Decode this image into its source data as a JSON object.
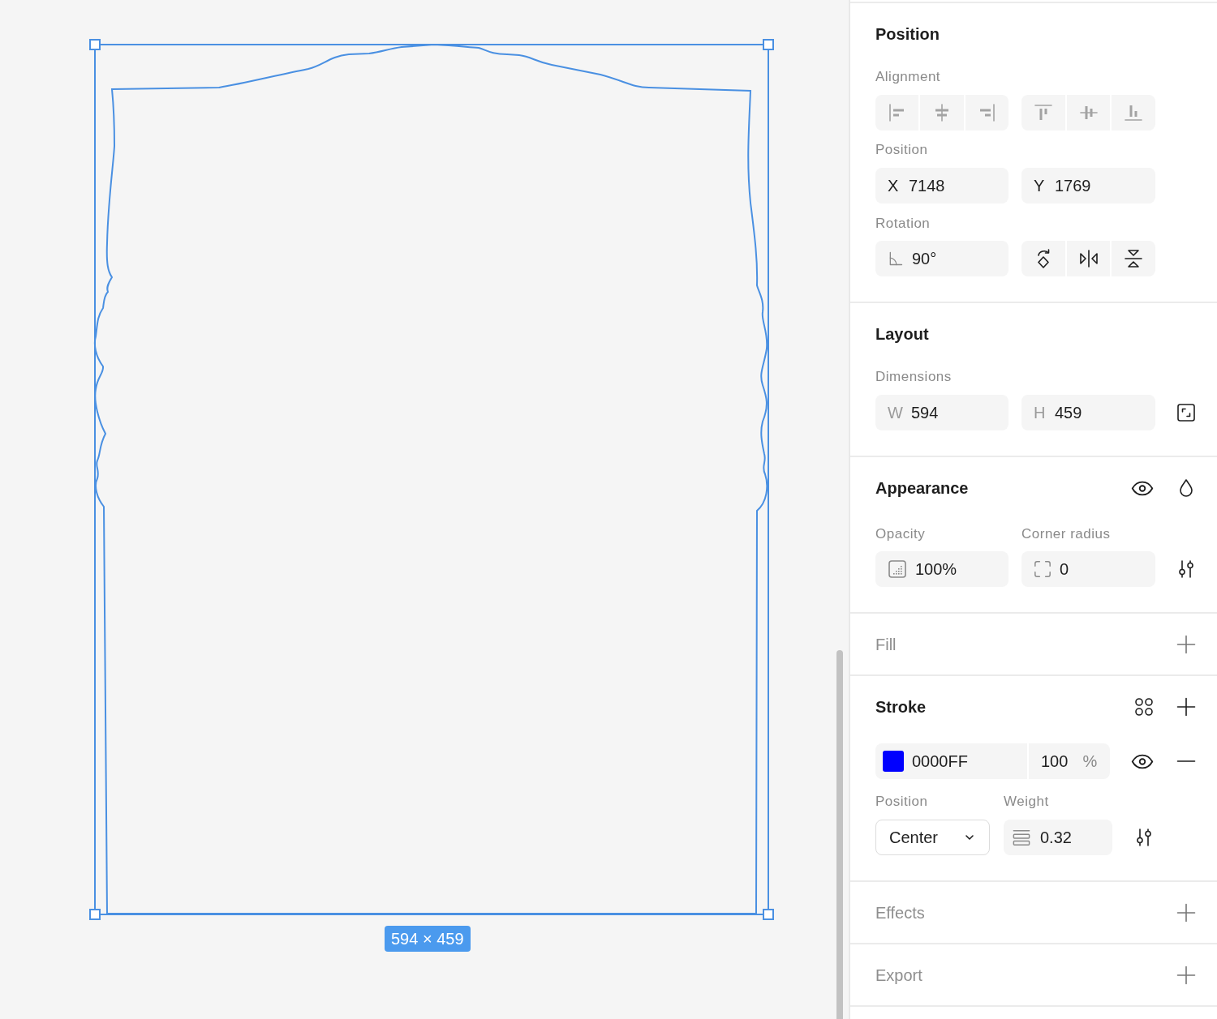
{
  "canvas": {
    "size_label": "594 × 459"
  },
  "sections": [
    {
      "kind": "position",
      "title": "Position",
      "empty": false,
      "alignment": {
        "label": "Alignment",
        "buttons": [
          {
            "kind": "left",
            "disabled": true
          },
          {
            "kind": "center",
            "disabled": true
          },
          {
            "kind": "right",
            "disabled": true
          },
          {
            "kind": "top",
            "disabled": true
          },
          {
            "kind": "middle",
            "disabled": true
          },
          {
            "kind": "bottom",
            "disabled": true
          }
        ]
      },
      "position": {
        "label": "Position",
        "fields": [
          {
            "prefix": "X",
            "value": "7148"
          },
          {
            "prefix": "Y",
            "value": "1769"
          }
        ]
      },
      "rotation": {
        "label": "Rotation",
        "value": "90°",
        "buttons": [
          {
            "kind": "rotate",
            "disabled": false
          },
          {
            "kind": "flip-horizontal",
            "disabled": false
          },
          {
            "kind": "flip-vertical",
            "disabled": false
          }
        ]
      }
    },
    {
      "kind": "layout",
      "title": "Layout",
      "empty": false,
      "dimensions": {
        "label": "Dimensions",
        "fields": [
          {
            "prefix": "W",
            "value": "594"
          },
          {
            "prefix": "H",
            "value": "459"
          }
        ]
      }
    },
    {
      "kind": "appearance",
      "title": "Appearance",
      "empty": false,
      "opacity": {
        "label": "Opacity",
        "value": "100%"
      },
      "corner_radius": {
        "label": "Corner radius",
        "value": "0"
      }
    },
    {
      "kind": "fill",
      "title": "Fill",
      "empty": true
    },
    {
      "kind": "stroke",
      "title": "Stroke",
      "empty": false,
      "paint": {
        "color": "#0000ff",
        "hex": "0000FF",
        "opacity": "100",
        "unit": "%"
      },
      "position": {
        "label": "Position",
        "value": "Center"
      },
      "weight": {
        "label": "Weight",
        "value": "0.32"
      }
    },
    {
      "kind": "effects",
      "title": "Effects",
      "empty": true
    },
    {
      "kind": "export",
      "title": "Export",
      "empty": true
    }
  ]
}
